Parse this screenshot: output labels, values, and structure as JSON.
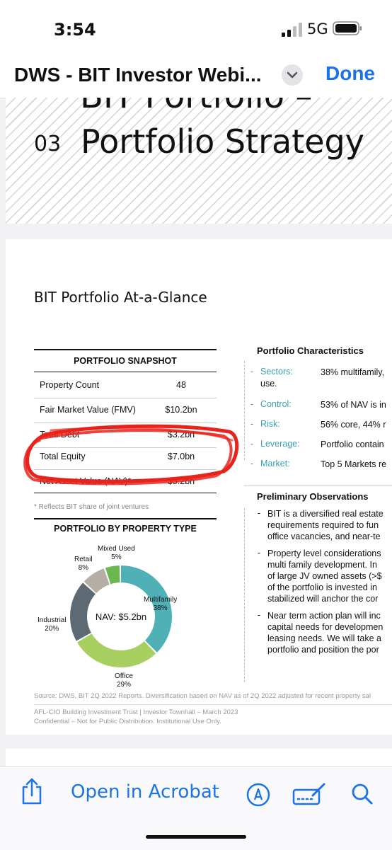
{
  "status": {
    "time": "3:54",
    "network": "5G"
  },
  "nav": {
    "title": "DWS - BIT Investor Webi...",
    "done": "Done"
  },
  "slide1": {
    "partial_title": "BIT Portfolio –",
    "section_number": "03",
    "section_title": "Portfolio Strategy"
  },
  "slide2": {
    "heading": "BIT Portfolio At-a-Glance",
    "snapshot": {
      "title": "PORTFOLIO SNAPSHOT",
      "rows": [
        {
          "label": "Property Count",
          "value": "48"
        },
        {
          "label": "Fair Market Value (FMV)",
          "value": "$10.2bn"
        },
        {
          "label": "Total Debt",
          "value": "$3.2bn"
        },
        {
          "label": "Total Equity",
          "value": "$7.0bn"
        },
        {
          "label": "Net Asset Value (NAV)*",
          "value": "$5.2bn"
        }
      ],
      "footnote": "* Reflects BIT share of joint ventures"
    },
    "property_type": {
      "title": "PORTFOLIO BY PROPERTY TYPE",
      "center_label": "NAV: $5.2bn",
      "segments": [
        {
          "name": "Multifamily",
          "pct_label": "38%",
          "value": 38,
          "color": "#4fb0b6"
        },
        {
          "name": "Office",
          "pct_label": "29%",
          "value": 29,
          "color": "#a8d060"
        },
        {
          "name": "Industrial",
          "pct_label": "20%",
          "value": 20,
          "color": "#5e6a73"
        },
        {
          "name": "Retail",
          "pct_label": "8%",
          "value": 8,
          "color": "#b5aea6"
        },
        {
          "name": "Mixed Used",
          "pct_label": "5%",
          "value": 5,
          "color": "#6ab84f"
        }
      ]
    },
    "characteristics": {
      "title": "Portfolio Characteristics",
      "items": [
        {
          "key": "Sectors:",
          "value_lines": [
            "38% multifamily,",
            "use."
          ]
        },
        {
          "key": "Control:",
          "value_lines": [
            "53% of NAV is in"
          ]
        },
        {
          "key": "Risk:",
          "value_lines": [
            "56% core, 44% r"
          ]
        },
        {
          "key": "Leverage:",
          "value_lines": [
            "Portfolio contain"
          ]
        },
        {
          "key": "Market:",
          "value_lines": [
            "Top 5 Markets re"
          ]
        }
      ]
    },
    "observations": {
      "title": "Preliminary Observations",
      "items": [
        {
          "lines": [
            "BIT is a diversified real estate",
            "requirements required to fun",
            "office vacancies, and near-te"
          ]
        },
        {
          "lines": [
            "Property level considerations",
            "multi family development. In",
            "of large JV owned assets (>$",
            "of the portfolio is invested in",
            "stabilized will anchor the cor"
          ]
        },
        {
          "lines": [
            "Near term action plan will inc",
            "capital needs for developmen",
            "leasing needs. We will take a",
            "portfolio and position the por"
          ]
        }
      ]
    },
    "source_note": "Source: DWS, BIT 2Q 2022 Reports.  Diversification based on NAV as of 2Q 2022 adjusted for recent property sal",
    "footer_line1": "AFL-CIO Building Investment Trust | Investor Townhall – March 2023",
    "footer_line2": "Confidential – Not for Public Distribution. Institutional Use Only."
  },
  "toolbar": {
    "open_acrobat": "Open in Acrobat"
  },
  "icons": [
    "signal-icon",
    "battery-icon",
    "chevron-down-icon",
    "share-icon",
    "markup-pen-icon",
    "signature-icon",
    "search-icon"
  ],
  "colors": {
    "accent": "#1a73e8",
    "teal": "#3aa0ae",
    "marker": "#e8231b"
  }
}
